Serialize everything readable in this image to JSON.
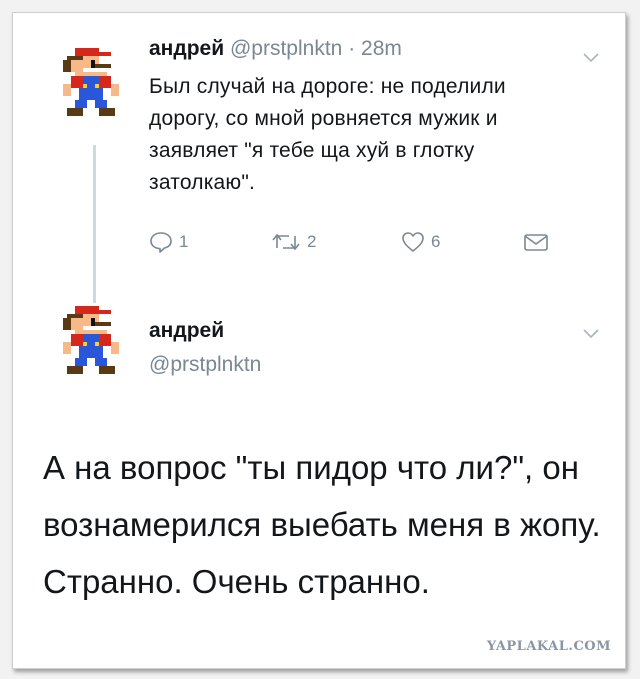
{
  "tweet1": {
    "display_name": "андрей",
    "handle": "@prstplnktn",
    "separator": "·",
    "time": "28m",
    "text": "Был случай на дороге: не поделили дорогу, со мной ровняется мужик и заявляет \"я тебе ща хуй в глотку затолкаю\".",
    "reply_count": "1",
    "retweet_count": "2",
    "like_count": "6"
  },
  "tweet2": {
    "display_name": "андрей",
    "handle": "@prstplnktn",
    "text": "А на вопрос \"ты пидор что ли?\", он вознамерился выебать меня в жопу. Странно. Очень странно."
  },
  "watermark": "YAPLAKAL.COM",
  "icons": [
    "mario-avatar",
    "chevron-down-icon",
    "reply-icon",
    "retweet-icon",
    "like-icon",
    "dm-icon"
  ],
  "colors": {
    "text": "#14171a",
    "muted": "#7a8893",
    "thread_line": "#cfd8dc"
  }
}
